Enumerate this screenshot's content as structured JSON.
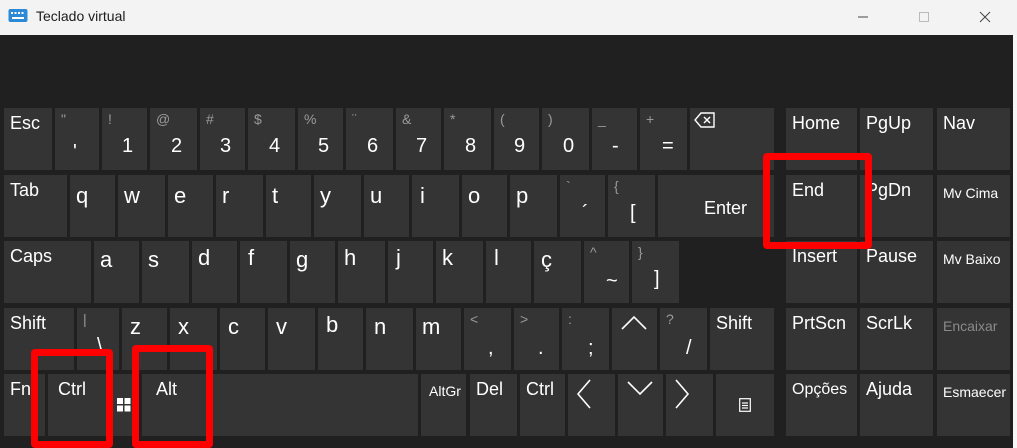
{
  "window": {
    "title": "Teclado virtual",
    "minimize_icon": "minimize-icon",
    "maximize_icon": "maximize-icon",
    "close_icon": "close-icon"
  },
  "keys": {
    "row1": [
      {
        "label": "Esc"
      },
      {
        "main": "'",
        "sub": "\""
      },
      {
        "main": "1",
        "sub": "!"
      },
      {
        "main": "2",
        "sub": "@"
      },
      {
        "main": "3",
        "sub": "#"
      },
      {
        "main": "4",
        "sub": "$"
      },
      {
        "main": "5",
        "sub": "%"
      },
      {
        "main": "6",
        "sub": "¨"
      },
      {
        "main": "7",
        "sub": "&"
      },
      {
        "main": "8",
        "sub": "*"
      },
      {
        "main": "9",
        "sub": "("
      },
      {
        "main": "0",
        "sub": ")"
      },
      {
        "main": "-",
        "sub": "_"
      },
      {
        "main": "=",
        "sub": "+"
      },
      {
        "icon": "backspace-icon"
      }
    ],
    "row2": [
      {
        "label": "Tab"
      },
      {
        "main": "q"
      },
      {
        "main": "w"
      },
      {
        "main": "e"
      },
      {
        "main": "r"
      },
      {
        "main": "t"
      },
      {
        "main": "y"
      },
      {
        "main": "u"
      },
      {
        "main": "i"
      },
      {
        "main": "o"
      },
      {
        "main": "p"
      },
      {
        "main": "´",
        "sub": "`"
      },
      {
        "main": "[",
        "sub": "{"
      },
      {
        "label": "Enter"
      }
    ],
    "row3": [
      {
        "label": "Caps"
      },
      {
        "main": "a"
      },
      {
        "main": "s"
      },
      {
        "main": "d"
      },
      {
        "main": "f"
      },
      {
        "main": "g"
      },
      {
        "main": "h"
      },
      {
        "main": "j"
      },
      {
        "main": "k"
      },
      {
        "main": "l"
      },
      {
        "main": "ç"
      },
      {
        "main": "~",
        "sub": "^"
      },
      {
        "main": "]",
        "sub": "}"
      }
    ],
    "row4": [
      {
        "label": "Shift"
      },
      {
        "main": "\\",
        "sub": "|"
      },
      {
        "main": "z"
      },
      {
        "main": "x"
      },
      {
        "main": "c"
      },
      {
        "main": "v"
      },
      {
        "main": "b"
      },
      {
        "main": "n"
      },
      {
        "main": "m"
      },
      {
        "main": ",",
        "sub": "<"
      },
      {
        "main": ".",
        "sub": ">"
      },
      {
        "main": ";",
        "sub": ":"
      },
      {
        "icon": "arrow-up-icon"
      },
      {
        "main": "/",
        "sub": "?"
      },
      {
        "label": "Shift"
      }
    ],
    "row5": [
      {
        "label": "Fn"
      },
      {
        "label": "Ctrl"
      },
      {
        "icon": "windows-icon"
      },
      {
        "label": "Alt"
      },
      {
        "label": "AltGr"
      },
      {
        "label": "Del"
      },
      {
        "label": "Ctrl"
      },
      {
        "icon": "arrow-left-icon"
      },
      {
        "icon": "arrow-down-icon"
      },
      {
        "icon": "arrow-right-icon"
      },
      {
        "icon": "context-menu-icon"
      }
    ],
    "nav": [
      [
        "Home",
        "PgUp",
        "Nav"
      ],
      [
        "End",
        "PgDn",
        "Mv Cima"
      ],
      [
        "Insert",
        "Pause",
        "Mv Baixo"
      ],
      [
        "PrtScn",
        "ScrLk",
        "Encaixar"
      ],
      [
        "Opções",
        "Ajuda",
        "Esmaecer"
      ]
    ]
  },
  "colors": {
    "background": "#202020",
    "key": "#343434",
    "text": "#ffffff",
    "secondary_text": "#9a9a9a",
    "highlight": "#ff0000"
  }
}
